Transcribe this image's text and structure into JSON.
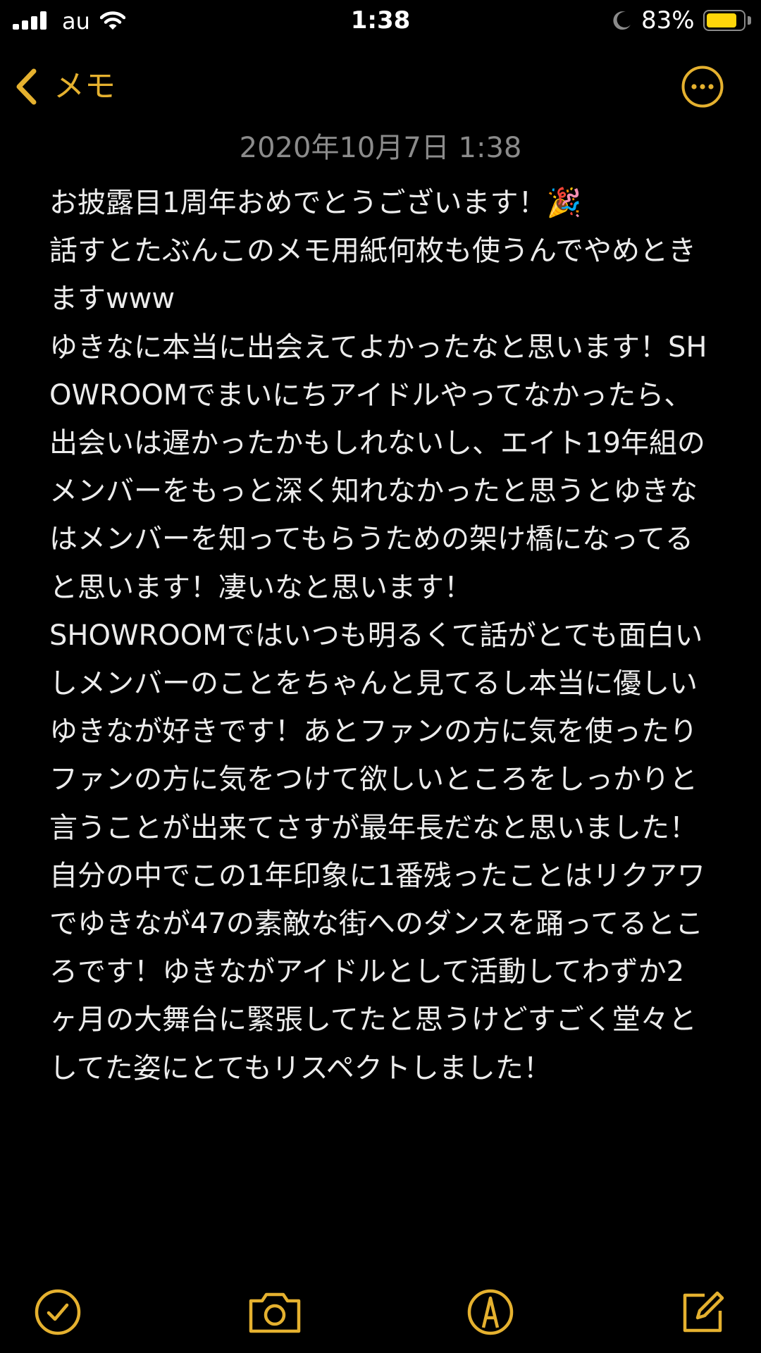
{
  "status_bar": {
    "carrier": "au",
    "time": "1:38",
    "battery_percent": "83%",
    "battery_level": 0.83,
    "icons": [
      "signal-icon",
      "wifi-icon",
      "moon-icon",
      "battery-icon"
    ]
  },
  "nav": {
    "back_label": "メモ",
    "back_icon": "chevron-left-icon",
    "more_icon": "ellipsis-circle-icon"
  },
  "note": {
    "date": "2020年10月7日 1:38",
    "body": "お披露目1周年おめでとうございます！🎉\n話すとたぶんこのメモ用紙何枚も使うんでやめときますwww\nゆきなに本当に出会えてよかったなと思います！SHOWROOMでまいにちアイドルやってなかったら、出会いは遅かったかもしれないし、エイト19年組のメンバーをもっと深く知れなかったと思うとゆきなはメンバーを知ってもらうための架け橋になってると思います！凄いなと思います！\nSHOWROOMではいつも明るくて話がとても面白いしメンバーのことをちゃんと見てるし本当に優しいゆきなが好きです！あとファンの方に気を使ったりファンの方に気をつけて欲しいところをしっかりと言うことが出来てさすが最年長だなと思いました！\n自分の中でこの1年印象に1番残ったことはリクアワでゆきなが47の素敵な街へのダンスを踊ってるところです！ゆきながアイドルとして活動してわずか2ヶ月の大舞台に緊張してたと思うけどすごく堂々としてた姿にとてもリスペクトしました！"
  },
  "toolbar": {
    "icons": [
      "checklist-icon",
      "camera-icon",
      "markup-icon",
      "compose-icon"
    ]
  },
  "colors": {
    "accent": "#e5b12f",
    "background": "#000000",
    "text": "#ececec",
    "date_text": "#8b8b8b",
    "battery": "#ffd60a"
  }
}
